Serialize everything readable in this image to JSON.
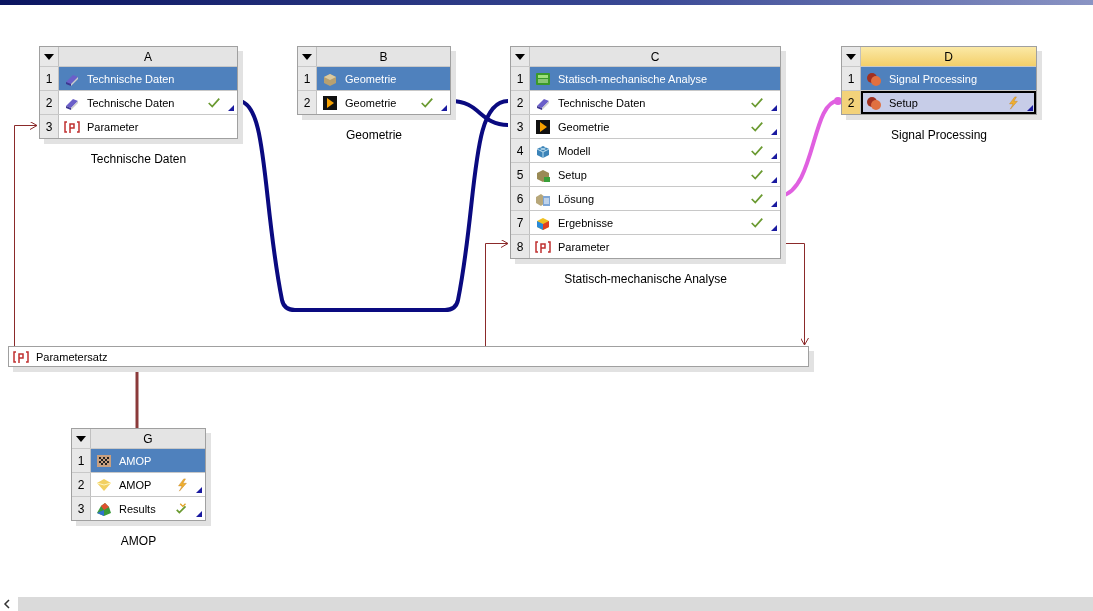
{
  "systems": [
    {
      "letter": "A",
      "caption": "Technische Daten",
      "selected": false,
      "rows": [
        {
          "num": "1",
          "label": "Technische Daten",
          "kind": "book",
          "title": true,
          "selected": false
        },
        {
          "num": "2",
          "label": "Technische Daten",
          "kind": "book",
          "status": {
            "kind": "ok"
          },
          "selected": false
        },
        {
          "num": "3",
          "label": "Parameter",
          "kind": "parameter",
          "selected": false
        }
      ]
    },
    {
      "letter": "B",
      "caption": "Geometrie",
      "selected": false,
      "rows": [
        {
          "num": "1",
          "label": "Geometrie",
          "kind": "block",
          "title": true,
          "selected": false
        },
        {
          "num": "2",
          "label": "Geometrie",
          "kind": "play",
          "status": {
            "kind": "ok"
          },
          "selected": false
        }
      ]
    },
    {
      "letter": "C",
      "caption": "Statisch-mechanische Analyse",
      "selected": false,
      "rows": [
        {
          "num": "1",
          "label": "Statisch-mechanische Analyse",
          "kind": "analysis",
          "title": true,
          "selected": false
        },
        {
          "num": "2",
          "label": "Technische Daten",
          "kind": "book",
          "status": {
            "kind": "ok"
          },
          "selected": false
        },
        {
          "num": "3",
          "label": "Geometrie",
          "kind": "play",
          "status": {
            "kind": "ok"
          },
          "selected": false
        },
        {
          "num": "4",
          "label": "Modell",
          "kind": "mesh",
          "status": {
            "kind": "ok"
          },
          "selected": false
        },
        {
          "num": "5",
          "label": "Setup",
          "kind": "setup",
          "status": {
            "kind": "ok"
          },
          "selected": false
        },
        {
          "num": "6",
          "label": "Lösung",
          "kind": "solver",
          "status": {
            "kind": "ok"
          },
          "selected": false
        },
        {
          "num": "7",
          "label": "Ergebnisse",
          "kind": "results",
          "status": {
            "kind": "ok"
          },
          "selected": false
        },
        {
          "num": "8",
          "label": "Parameter",
          "kind": "parameter",
          "selected": false
        }
      ]
    },
    {
      "letter": "D",
      "caption": "Signal Processing",
      "selected": true,
      "rows": [
        {
          "num": "1",
          "label": "Signal Processing",
          "kind": "signal",
          "title": true,
          "selected": false
        },
        {
          "num": "2",
          "label": "Setup",
          "kind": "signal",
          "status": {
            "kind": "update"
          },
          "selected": true
        }
      ]
    },
    {
      "letter": "G",
      "caption": "AMOP",
      "selected": false,
      "rows": [
        {
          "num": "1",
          "label": "AMOP",
          "kind": "checker",
          "title": true,
          "selected": false
        },
        {
          "num": "2",
          "label": "AMOP",
          "kind": "diamond",
          "status": {
            "kind": "update"
          },
          "selected": false
        },
        {
          "num": "3",
          "label": "Results",
          "kind": "surface",
          "status": {
            "kind": "refresh"
          },
          "selected": false
        }
      ]
    }
  ],
  "parameter_set": {
    "label": "Parametersatz"
  }
}
